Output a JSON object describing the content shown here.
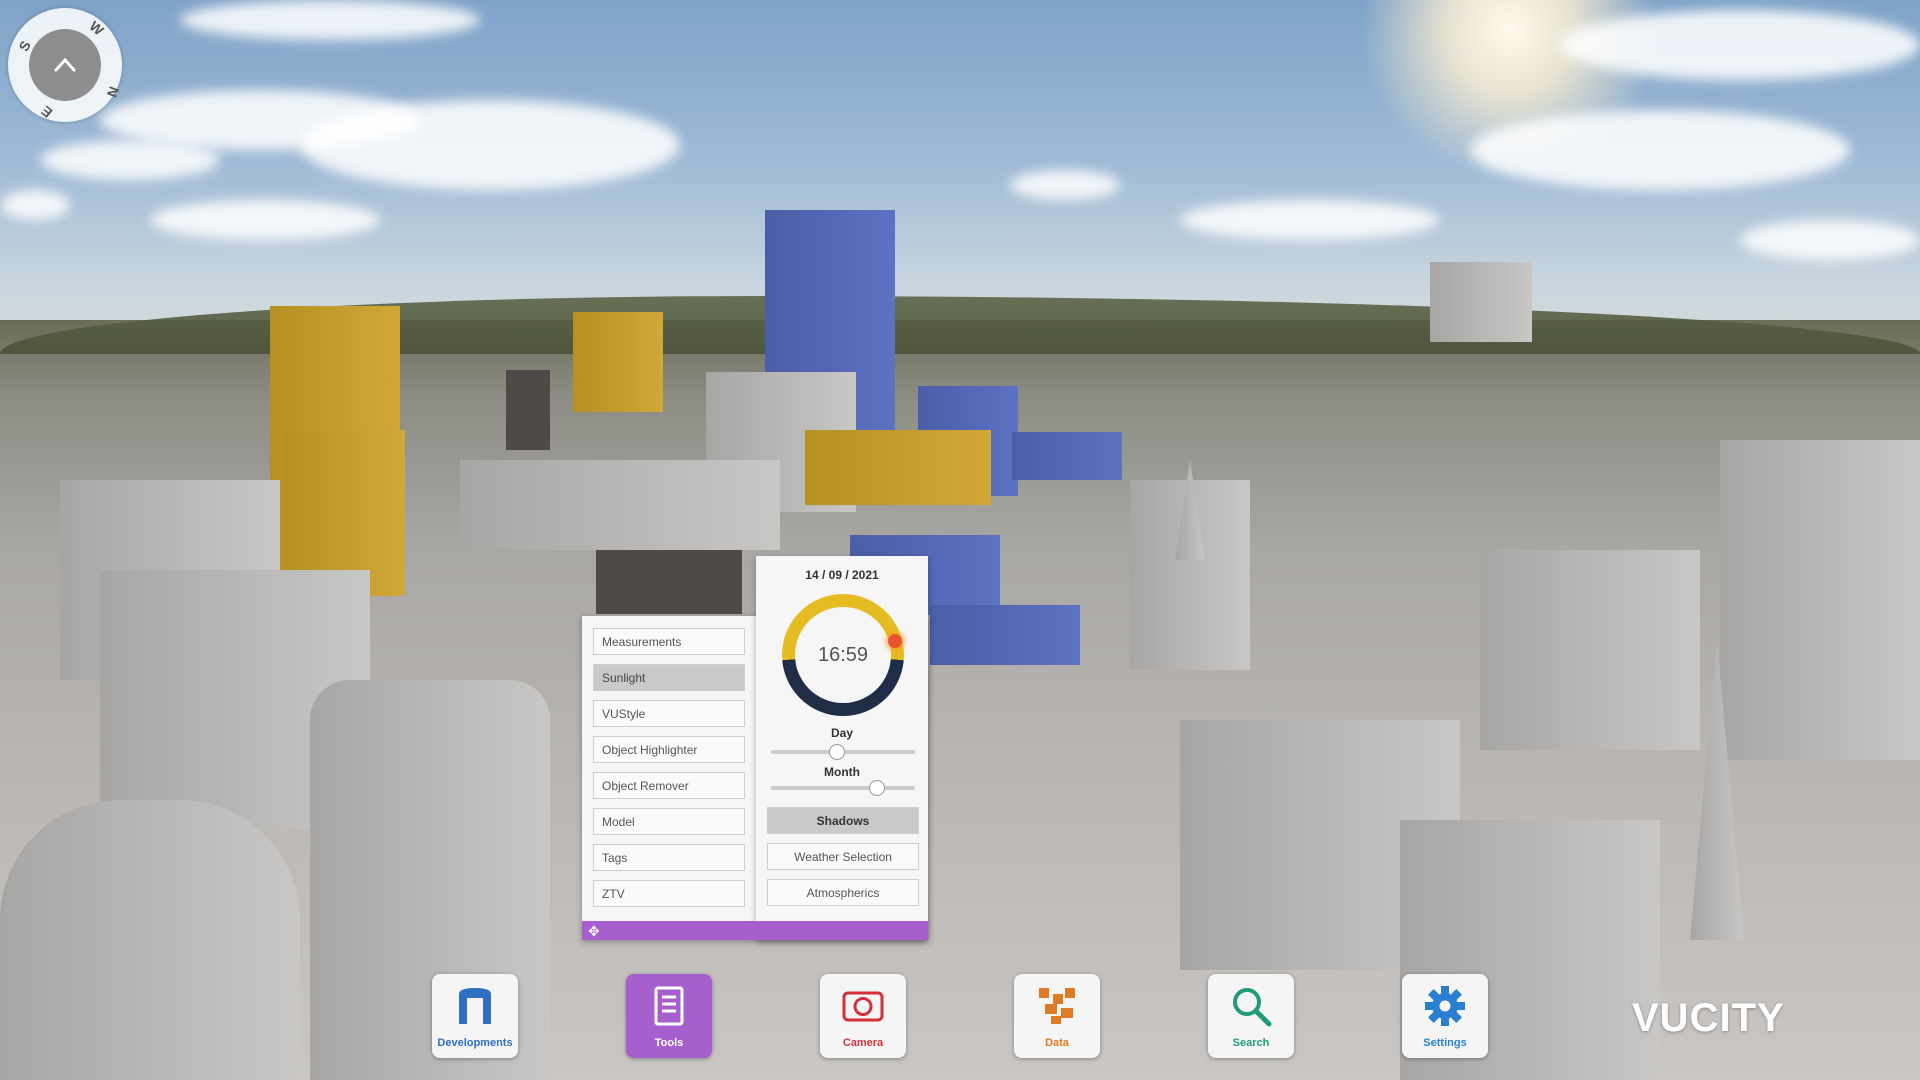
{
  "compass": {
    "north": "N",
    "south": "S",
    "east": "E",
    "west": "W"
  },
  "tools": {
    "items": [
      {
        "label": "Measurements",
        "active": false
      },
      {
        "label": "Sunlight",
        "active": true
      },
      {
        "label": "VUStyle",
        "active": false
      },
      {
        "label": "Object Highlighter",
        "active": false
      },
      {
        "label": "Object Remover",
        "active": false
      },
      {
        "label": "Model",
        "active": false
      },
      {
        "label": "Tags",
        "active": false
      },
      {
        "label": "ZTV",
        "active": false
      }
    ]
  },
  "sunlight": {
    "date": "14 / 09 / 2021",
    "time": "16:59",
    "day_label": "Day",
    "day_value": 14,
    "day_max": 30,
    "month_label": "Month",
    "month_value": 9,
    "month_max": 12,
    "shadows_label": "Shadows",
    "weather_label": "Weather Selection",
    "atmospherics_label": "Atmospherics"
  },
  "dock": [
    {
      "label": "Developments",
      "icon": "developments-icon",
      "color": "#2f6fc2",
      "active": false
    },
    {
      "label": "Tools",
      "icon": "tools-icon",
      "color": "#ffffff",
      "active": true
    },
    {
      "label": "Camera",
      "icon": "camera-icon",
      "color": "#d2303a",
      "active": false
    },
    {
      "label": "Data",
      "icon": "data-icon",
      "color": "#e07b25",
      "active": false
    },
    {
      "label": "Search",
      "icon": "search-icon",
      "color": "#1f9a7b",
      "active": false
    },
    {
      "label": "Settings",
      "icon": "settings-icon",
      "color": "#2a7fd0",
      "active": false
    }
  ],
  "logo": {
    "text": "VUCITY"
  },
  "colors": {
    "accent": "#a65fcc",
    "sun_ring_day": "#e6bc23",
    "sun_ring_night": "#1f2d47"
  }
}
